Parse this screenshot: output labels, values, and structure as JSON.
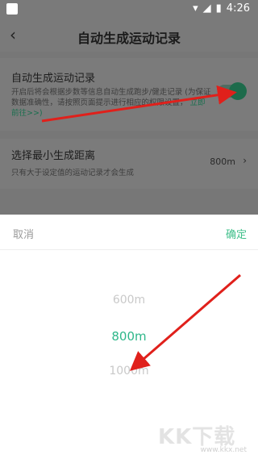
{
  "status_bar": {
    "time": "4:26"
  },
  "header": {
    "back_icon": "chevron-left-icon",
    "title": "自动生成运动记录"
  },
  "settings": {
    "auto_record": {
      "title": "自动生成运动记录",
      "desc_line1": "开启后将会根据步数等信息自动生成跑步/健走记录",
      "desc_line2": "(为保证数据准确性，请按照页面提示进行相应的权限设置，",
      "desc_link": "立即前往>>)",
      "toggle_on": true,
      "toggle_color": "#1d6b4b"
    },
    "min_distance": {
      "title": "选择最小生成距离",
      "desc": "只有大于设定值的运动记录才会生成",
      "value": "800m",
      "chevron_icon": "chevron-right-icon"
    }
  },
  "picker_sheet": {
    "cancel_label": "取消",
    "confirm_label": "确定",
    "options": [
      "600m",
      "800m",
      "1000m"
    ],
    "selected": "800m",
    "accent_color": "#2eb78a"
  },
  "watermark": {
    "text": "KK下载",
    "url": "www.kkx.net"
  },
  "annotations": {
    "arrow_color": "#e0201b"
  }
}
